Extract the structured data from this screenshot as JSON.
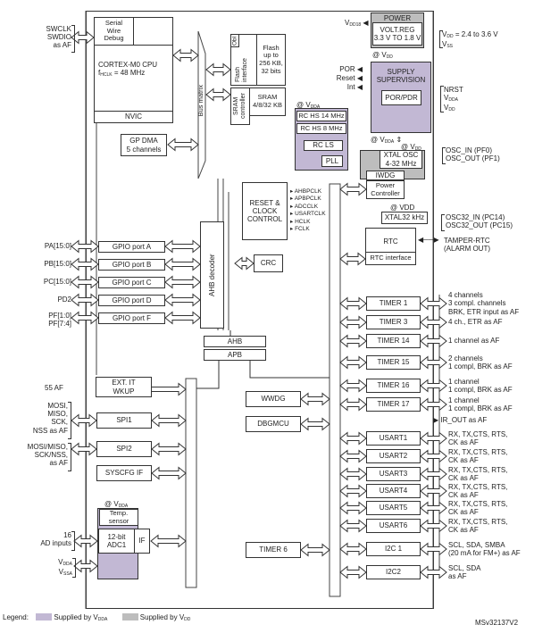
{
  "cpu": {
    "swd": "Serial\nWire\nDebug",
    "core": "CORTEX-M0 CPU",
    "freq_prefix": "f",
    "freq_sub": "HCLK",
    "freq_value": "= 48 MHz",
    "nvic": "NVIC",
    "pins": "SWCLK\nSWDIO\nas AF"
  },
  "memory": {
    "obl": "Obl",
    "flash_interface": "Flash interface",
    "flash": "Flash\nup to\n256 KB,\n32 bits",
    "sram_controller": "SRAM controller",
    "sram": "SRAM\n4/8/32 KB"
  },
  "bus_matrix": "Bus matrix",
  "gp_dma": "GP DMA\n5 channels",
  "power": {
    "title": "POWER",
    "volt_reg": "VOLT.REG\n3.3 V TO 1.8 V",
    "vdd18": "V",
    "vdd18_sub": "DD18",
    "at_vdd": "@ V",
    "at_vdd_sub": "DD",
    "supply_range": "= 2.4 to 3.6 V",
    "vdd_label": "V",
    "vdd_sub": "DD",
    "vss_label": "V",
    "vss_sub": "SS"
  },
  "supply_supervision": {
    "title": "SUPPLY\nSUPERVISION",
    "por_pdr": "POR/PDR",
    "outputs": [
      "POR",
      "Reset",
      "Int"
    ],
    "pins": [
      "NRST",
      "V",
      "V"
    ],
    "pin_subs": [
      "",
      "DDA",
      "DD"
    ]
  },
  "oscillators": {
    "at_vdda": "@ V",
    "at_vdda_sub": "DDA",
    "rc_hs14": "RC HS 14 MHz",
    "rc_hs8": "RC HS 8 MHz",
    "rc_ls": "RC LS",
    "pll": "PLL",
    "at_vdda2": "@ V",
    "at_vdda2_sub": "DDA",
    "at_vdd2": "@ V",
    "at_vdd2_sub": "DD",
    "xtal": "XTAL OSC\n4-32 MHz",
    "osc_pins": "OSC_IN (PF0)\nOSC_OUT (PF1)",
    "iwdg": "IWDG",
    "power_controller": "Power\nController"
  },
  "rcc": {
    "title": "RESET &\nCLOCK\nCONTROL",
    "clocks": [
      "AHBPCLK",
      "APBPCLK",
      "ADCCLK",
      "USARTCLK",
      "HCLK",
      "FCLK"
    ]
  },
  "rtc": {
    "at_vdd": "@ VDD",
    "xtal32": "XTAL32 kHz",
    "osc32_pins": "OSC32_IN (PC14)\nOSC32_OUT (PC15)",
    "rtc": "RTC",
    "rtc_interface": "RTC interface",
    "tamper": "TAMPER-RTC\n(ALARM OUT)"
  },
  "gpio": {
    "decoder": "AHB decoder",
    "ports": [
      {
        "pins": "PA[15:0]",
        "label": "GPIO port A"
      },
      {
        "pins": "PB[15:0]",
        "label": "GPIO port B"
      },
      {
        "pins": "PC[15:0]",
        "label": "GPIO port C"
      },
      {
        "pins": "PD2",
        "label": "GPIO port D"
      },
      {
        "pins": "PF[1:0]\nPF[7:4]",
        "label": "GPIO port F"
      }
    ]
  },
  "crc": "CRC",
  "bus": {
    "ahb": "AHB",
    "apb": "APB"
  },
  "left_peripherals": {
    "exti": "EXT. IT\nWKUP",
    "exti_pins": "55 AF",
    "spi1": "SPI1",
    "spi1_pins": "MOSI,\nMISO,\nSCK,\nNSS as AF",
    "spi2": "SPI2",
    "spi2_pins": "MOSI/MISO,\nSCK/NSS,\nas AF",
    "syscfg": "SYSCFG IF"
  },
  "adc": {
    "at_vdda": "@ V",
    "at_vdda_sub": "DDA",
    "temp": "Temp.\nsensor",
    "adc": "12-bit\nADC1",
    "if": "IF",
    "inputs": "16\nAD inputs",
    "vdda": "V",
    "vdda_sub": "DDA",
    "vssa": "V",
    "vssa_sub": "SSA"
  },
  "middle": {
    "wwdg": "WWDG",
    "dbgmcu": "DBGMCU",
    "timer6": "TIMER 6"
  },
  "right_peripherals": [
    {
      "label": "TIMER 1",
      "desc": "4 channels\n3 compl. channels\nBRK, ETR input as AF"
    },
    {
      "label": "TIMER 3",
      "desc": "4 ch., ETR as AF"
    },
    {
      "label": "TIMER 14",
      "desc": "1 channel as AF"
    },
    {
      "label": "TIMER 15",
      "desc": "2 channels\n1 compl, BRK as AF"
    },
    {
      "label": "TIMER 16",
      "desc": "1 channel\n1 compl, BRK as AF"
    },
    {
      "label": "TIMER 17",
      "desc": "1 channel\n1 compl, BRK as AF"
    },
    {
      "label": "USART1",
      "desc": "RX, TX,CTS, RTS,\nCK as AF"
    },
    {
      "label": "USART2",
      "desc": "RX, TX,CTS, RTS,\nCK as AF"
    },
    {
      "label": "USART3",
      "desc": "RX, TX,CTS, RTS,\nCK as AF"
    },
    {
      "label": "USART4",
      "desc": "RX, TX,CTS, RTS,\nCK as AF"
    },
    {
      "label": "USART5",
      "desc": "RX, TX,CTS, RTS,\nCK as AF"
    },
    {
      "label": "USART6",
      "desc": "RX, TX,CTS, RTS,\nCK as AF"
    },
    {
      "label": "I2C 1",
      "desc": "SCL, SDA, SMBA\n(20 mA for FM+) as AF"
    },
    {
      "label": "I2C2",
      "desc": "SCL, SDA\nas AF"
    }
  ],
  "ir_out": "IR_OUT as AF",
  "legend": {
    "title": "Legend:",
    "vdda_text": "Supplied by V",
    "vdda_sub": "DDA",
    "vdd_text": "Supplied by V",
    "vdd_sub": "DD",
    "vdda_color": "#c2b8d4",
    "vdd_color": "#bdbdbd"
  },
  "figure_id": "MSv32137V2"
}
